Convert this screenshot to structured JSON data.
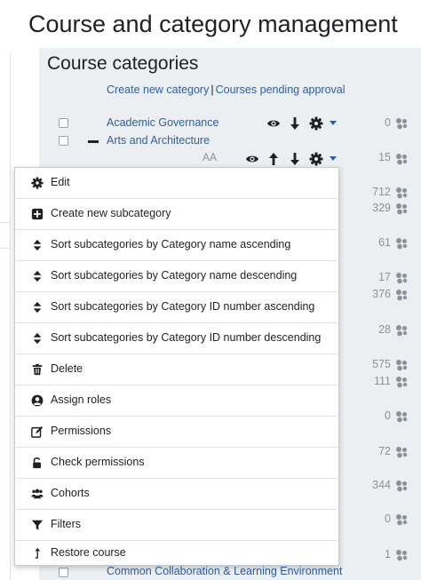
{
  "page": {
    "title": "Course and category management"
  },
  "panel": {
    "title": "Course categories",
    "create_link": "Create new category",
    "separator": "|",
    "pending_link": "Courses pending approval"
  },
  "categories": [
    {
      "name": "Academic Governance",
      "count": "0"
    },
    {
      "name": "Arts and Architecture",
      "idnumber": "AA",
      "count": "15"
    }
  ],
  "hidden_counts": [
    "712",
    "329",
    "61",
    "17",
    "376",
    "28",
    "575",
    "111",
    "0",
    "72",
    "344",
    "0",
    "1"
  ],
  "menu": {
    "items": [
      {
        "label": "Edit",
        "icon": "gear-icon"
      },
      {
        "label": "Create new subcategory",
        "icon": "plus-square-icon"
      },
      {
        "label": "Sort subcategories by Category name ascending",
        "icon": "sort-icon"
      },
      {
        "label": "Sort subcategories by Category name descending",
        "icon": "sort-icon"
      },
      {
        "label": "Sort subcategories by Category ID number ascending",
        "icon": "sort-icon"
      },
      {
        "label": "Sort subcategories by Category ID number descending",
        "icon": "sort-icon"
      },
      {
        "label": "Delete",
        "icon": "trash-icon"
      },
      {
        "label": "Assign roles",
        "icon": "user-circle-icon"
      },
      {
        "label": "Permissions",
        "icon": "edit-icon"
      },
      {
        "label": "Check permissions",
        "icon": "unlock-icon"
      },
      {
        "label": "Cohorts",
        "icon": "users-icon"
      },
      {
        "label": "Filters",
        "icon": "filter-icon"
      },
      {
        "label": "Restore course",
        "icon": "level-up-icon"
      }
    ]
  },
  "footer_category": {
    "name": "Common Collaboration & Learning Environment"
  },
  "colors": {
    "link": "#2b5fa6",
    "panel_bg": "#eceff1",
    "text": "#1d2125",
    "muted": "#8a9199"
  }
}
